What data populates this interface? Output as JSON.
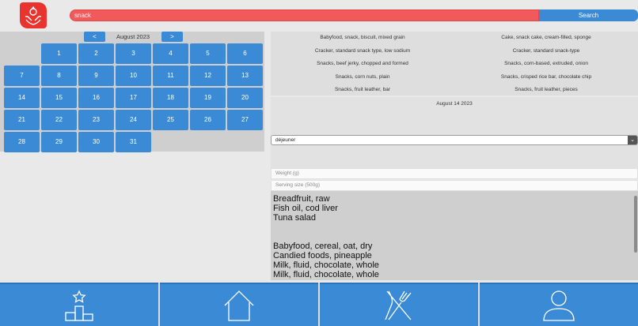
{
  "search": {
    "value": "snack",
    "button_label": "Search"
  },
  "calendar": {
    "prev_label": "<",
    "next_label": ">",
    "month_label": "August 2023",
    "leading_blanks": 1,
    "days": [
      "1",
      "2",
      "3",
      "4",
      "5",
      "6",
      "7",
      "8",
      "9",
      "10",
      "11",
      "12",
      "13",
      "14",
      "15",
      "16",
      "17",
      "18",
      "19",
      "20",
      "21",
      "22",
      "23",
      "24",
      "25",
      "26",
      "27",
      "28",
      "29",
      "30",
      "31"
    ]
  },
  "results": [
    "Babyfood, snack, biscuit, mixed grain",
    "Cake, snack cake, cream-filled, sponge",
    "Cracker, standard snack type, low sodium",
    "Cracker, standard snack-type",
    "Snacks, beef jerky, chopped and formed",
    "Snacks, corn-based, extruded, onion",
    "Snacks, corn nuts, plain",
    "Snacks, crisped rice bar, chocolate chip",
    "Snacks, fruit leather, bar",
    "Snacks, fruit leather, pieces"
  ],
  "selected_date": "August 14 2023",
  "meal": {
    "value": "déjeuner"
  },
  "weight_placeholder": "Weight (g)",
  "serving_placeholder": "Serving size (500g)",
  "foods": [
    "Breadfruit, raw",
    "Fish oil, cod liver",
    "Tuna salad",
    "",
    "",
    "Babyfood, cereal, oat, dry",
    "Candied foods, pineapple",
    "Milk, fluid, chocolate, whole",
    "Milk, fluid, chocolate, whole"
  ],
  "tabs": [
    {
      "icon": "podium-star-icon"
    },
    {
      "icon": "home-icon"
    },
    {
      "icon": "fork-knife-icon"
    },
    {
      "icon": "user-icon"
    }
  ],
  "colors": {
    "brand": "#e8332f",
    "search": "#f05a5a",
    "accent": "#3a8ad6"
  }
}
